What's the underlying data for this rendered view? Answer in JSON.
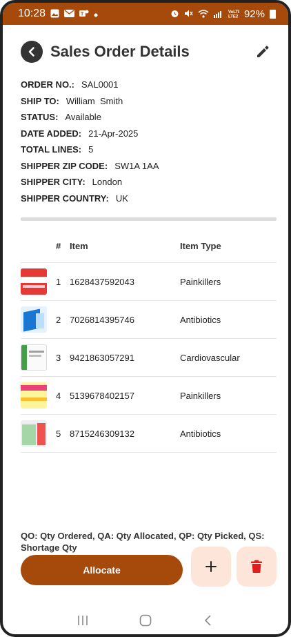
{
  "status_bar": {
    "time": "10:28",
    "left_icons": [
      "image-icon",
      "mail-icon",
      "teams-icon",
      "dot-icon"
    ],
    "right_icons": [
      "alarm-icon",
      "mute-icon",
      "wifi-icon",
      "signal-icon",
      "volte-icon"
    ],
    "battery": "92%",
    "bg_color": "#a64a0c"
  },
  "header": {
    "title": "Sales Order Details",
    "back_icon": "chevron-left-icon",
    "edit_icon": "pencil-icon"
  },
  "order_info": [
    {
      "label": "ORDER NO.:",
      "value": "SAL0001"
    },
    {
      "label": "SHIP TO:",
      "value": "William  Smith"
    },
    {
      "label": "STATUS:",
      "value": "Available"
    },
    {
      "label": "DATE ADDED:",
      "value": "21-Apr-2025"
    },
    {
      "label": "TOTAL LINES:",
      "value": "5"
    },
    {
      "label": "SHIPPER ZIP CODE:",
      "value": "SW1A 1AA"
    },
    {
      "label": "SHIPPER CITY:",
      "value": "London"
    },
    {
      "label": "SHIPPER COUNTRY:",
      "value": "UK"
    }
  ],
  "table": {
    "columns": [
      "#",
      "Item",
      "Item Type"
    ],
    "rows": [
      {
        "num": "1",
        "item": "1628437592043",
        "type": "Painkillers",
        "thumb": "ibuprofen-pack-image"
      },
      {
        "num": "2",
        "item": "7026814395746",
        "type": "Antibiotics",
        "thumb": "antibiotic-pack-image"
      },
      {
        "num": "3",
        "item": "9421863057291",
        "type": "Cardiovascular",
        "thumb": "cardio-pack-image"
      },
      {
        "num": "4",
        "item": "5139678402157",
        "type": "Painkillers",
        "thumb": "tablets-pack-image"
      },
      {
        "num": "5",
        "item": "8715246309132",
        "type": "Antibiotics",
        "thumb": "clarithromycin-pack-image"
      }
    ]
  },
  "legend": "QO: Qty Ordered, QA: Qty Allocated, QP: Qty Picked, QS: Shortage Qty",
  "actions": {
    "allocate_label": "Allocate",
    "add_icon": "plus-icon",
    "delete_icon": "trash-icon"
  },
  "nav_bar": [
    "recents-icon",
    "home-icon",
    "back-icon"
  ],
  "colors": {
    "accent": "#a64a0c",
    "button_soft": "#fde6d9",
    "delete_red": "#e11d1d"
  }
}
